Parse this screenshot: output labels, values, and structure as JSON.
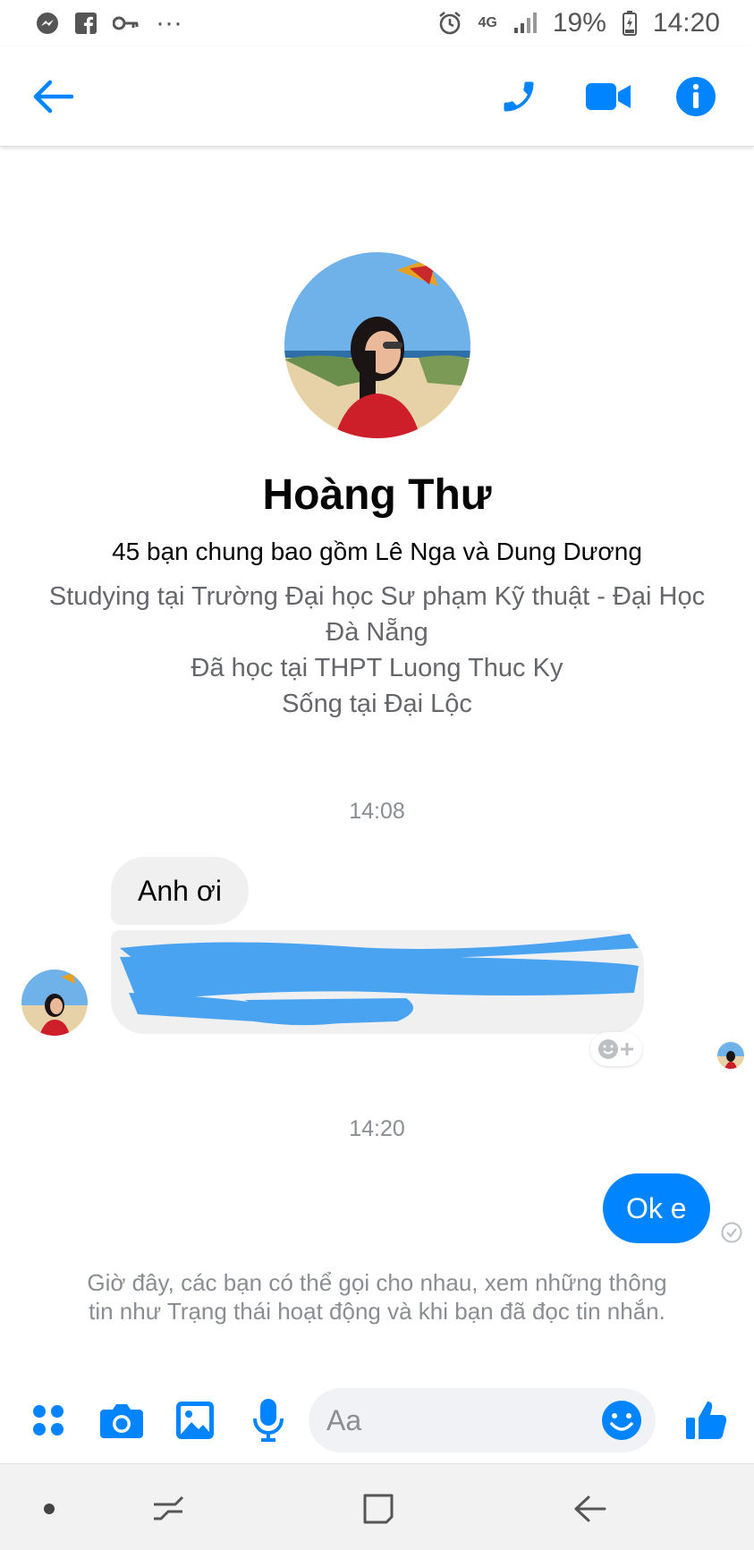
{
  "status_bar": {
    "network": "4G",
    "battery": "19%",
    "time": "14:20",
    "more": "···"
  },
  "header": {
    "icons": [
      "back-arrow-icon",
      "phone-icon",
      "video-camera-icon",
      "info-icon"
    ],
    "accent_color": "#0084ff"
  },
  "profile": {
    "name": "Hoàng Thư",
    "mutual_friends": "45 bạn chung bao gồm Lê Nga và Dung Dương",
    "details": [
      "Studying tại Trường Đại học Sư phạm Kỹ thuật - Đại Học Đà Nẵng",
      "Đã học tại THPT Luong Thuc Ky",
      "Sống tại Đại Lộc"
    ]
  },
  "conversation": {
    "timestamp_1": "14:08",
    "incoming_1": "Anh ơi",
    "incoming_2_redacted": true,
    "timestamp_2": "14:20",
    "outgoing_1": "Ok e",
    "info_note": "Giờ đây, các bạn có thể gọi cho nhau, xem những thông tin như Trạng thái hoạt động và khi bạn đã đọc tin nhắn."
  },
  "composer": {
    "placeholder": "Aa",
    "icons": [
      "apps-grid-icon",
      "camera-icon",
      "image-icon",
      "microphone-icon",
      "emoji-icon",
      "thumbs-up-icon"
    ]
  },
  "colors": {
    "messenger_blue": "#0084ff",
    "bubble_gray": "#f0f0f0",
    "redaction_blue": "#4aa3f0",
    "secondary_text": "#65676b"
  }
}
